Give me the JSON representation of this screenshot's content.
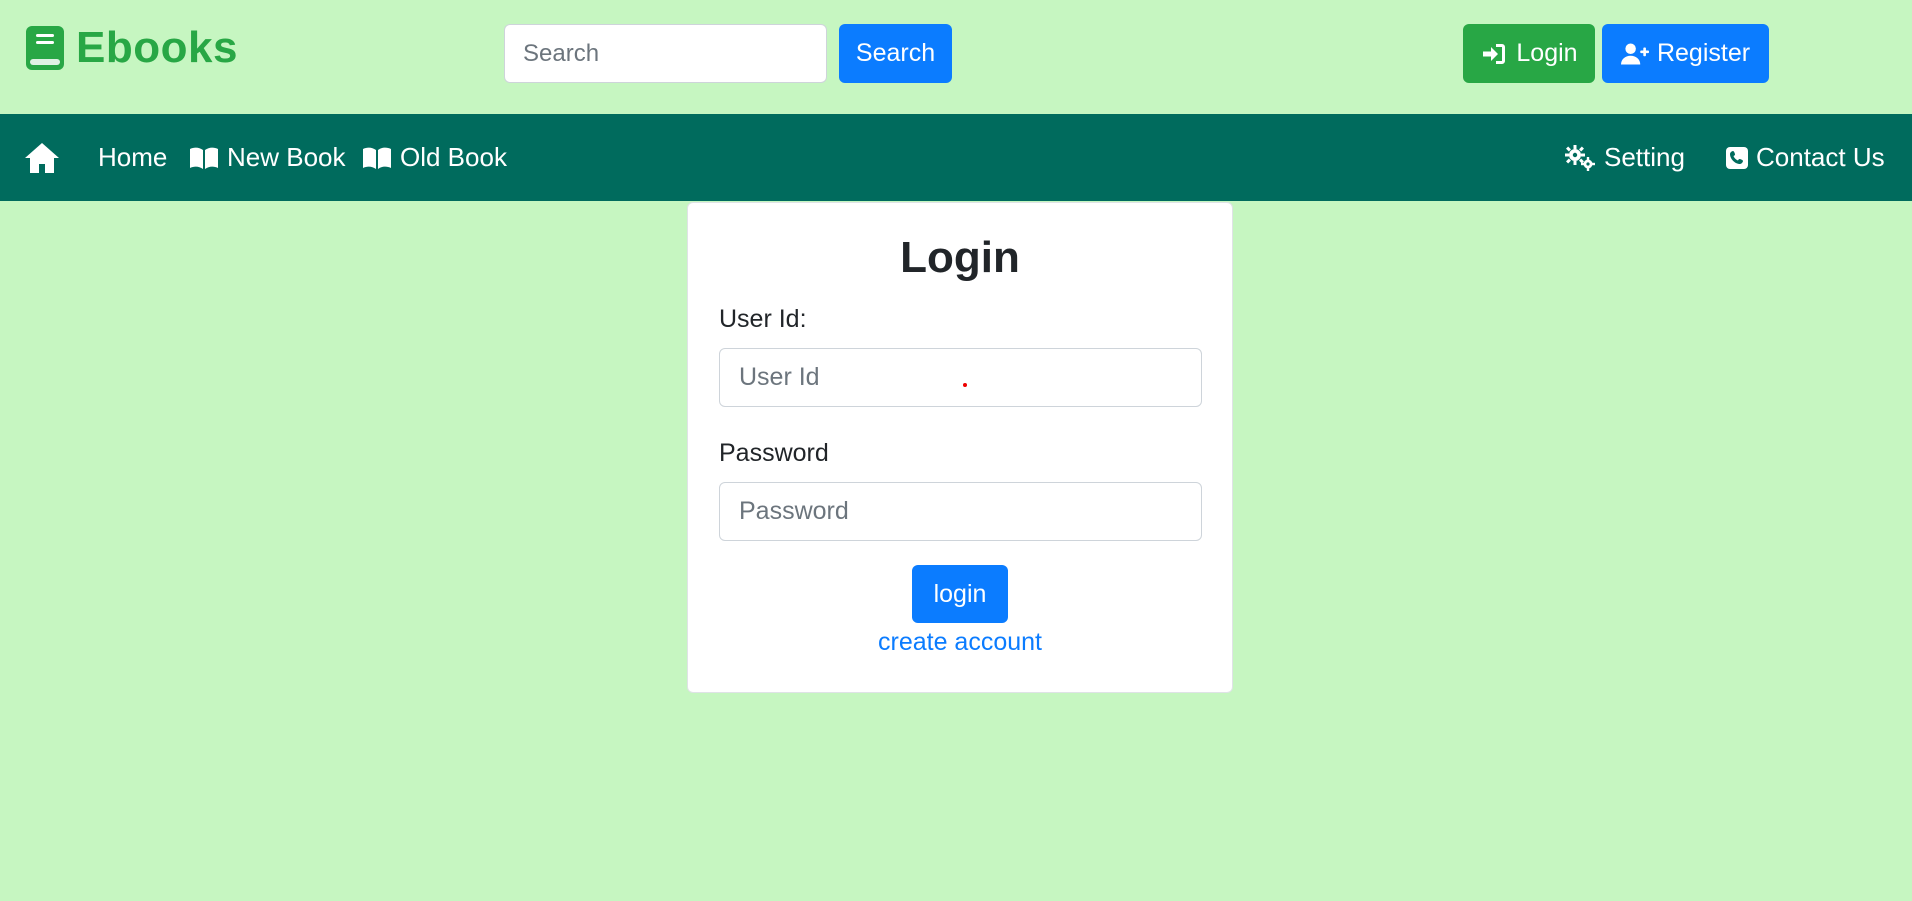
{
  "brand": {
    "name": "Ebooks",
    "icon": "book-icon",
    "color": "#28a745"
  },
  "header": {
    "search_placeholder": "Search",
    "search_button": "Search",
    "login_button": "Login",
    "register_button": "Register"
  },
  "nav": {
    "home_icon": "home-icon",
    "items": {
      "home": "Home",
      "new_book": "New Book",
      "old_book": "Old Book",
      "setting": "Setting",
      "contact": "Contact Us"
    }
  },
  "login_form": {
    "title": "Login",
    "user_label": "User Id:",
    "user_placeholder": "User Id",
    "password_label": "Password",
    "password_placeholder": "Password",
    "submit": "login",
    "create_account": "create account"
  },
  "colors": {
    "page_bg": "#c6f6c1",
    "nav_bg": "#006b5d",
    "primary": "#0b7cff",
    "success": "#28a745"
  }
}
